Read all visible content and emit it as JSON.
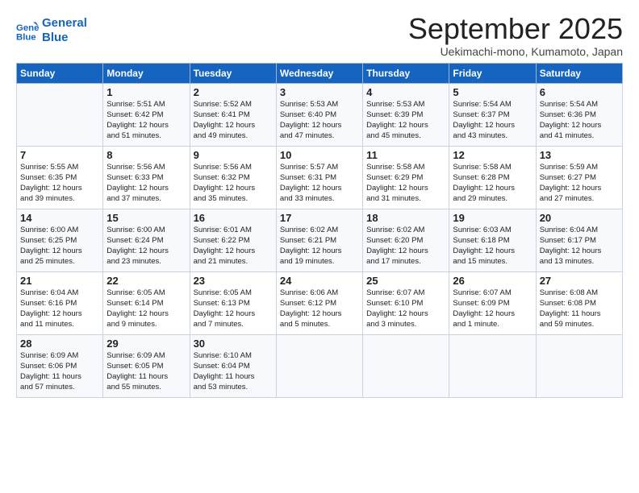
{
  "logo": {
    "line1": "General",
    "line2": "Blue"
  },
  "title": "September 2025",
  "subtitle": "Uekimachi-mono, Kumamoto, Japan",
  "headers": [
    "Sunday",
    "Monday",
    "Tuesday",
    "Wednesday",
    "Thursday",
    "Friday",
    "Saturday"
  ],
  "weeks": [
    [
      {
        "day": "",
        "text": ""
      },
      {
        "day": "1",
        "text": "Sunrise: 5:51 AM\nSunset: 6:42 PM\nDaylight: 12 hours\nand 51 minutes."
      },
      {
        "day": "2",
        "text": "Sunrise: 5:52 AM\nSunset: 6:41 PM\nDaylight: 12 hours\nand 49 minutes."
      },
      {
        "day": "3",
        "text": "Sunrise: 5:53 AM\nSunset: 6:40 PM\nDaylight: 12 hours\nand 47 minutes."
      },
      {
        "day": "4",
        "text": "Sunrise: 5:53 AM\nSunset: 6:39 PM\nDaylight: 12 hours\nand 45 minutes."
      },
      {
        "day": "5",
        "text": "Sunrise: 5:54 AM\nSunset: 6:37 PM\nDaylight: 12 hours\nand 43 minutes."
      },
      {
        "day": "6",
        "text": "Sunrise: 5:54 AM\nSunset: 6:36 PM\nDaylight: 12 hours\nand 41 minutes."
      }
    ],
    [
      {
        "day": "7",
        "text": "Sunrise: 5:55 AM\nSunset: 6:35 PM\nDaylight: 12 hours\nand 39 minutes."
      },
      {
        "day": "8",
        "text": "Sunrise: 5:56 AM\nSunset: 6:33 PM\nDaylight: 12 hours\nand 37 minutes."
      },
      {
        "day": "9",
        "text": "Sunrise: 5:56 AM\nSunset: 6:32 PM\nDaylight: 12 hours\nand 35 minutes."
      },
      {
        "day": "10",
        "text": "Sunrise: 5:57 AM\nSunset: 6:31 PM\nDaylight: 12 hours\nand 33 minutes."
      },
      {
        "day": "11",
        "text": "Sunrise: 5:58 AM\nSunset: 6:29 PM\nDaylight: 12 hours\nand 31 minutes."
      },
      {
        "day": "12",
        "text": "Sunrise: 5:58 AM\nSunset: 6:28 PM\nDaylight: 12 hours\nand 29 minutes."
      },
      {
        "day": "13",
        "text": "Sunrise: 5:59 AM\nSunset: 6:27 PM\nDaylight: 12 hours\nand 27 minutes."
      }
    ],
    [
      {
        "day": "14",
        "text": "Sunrise: 6:00 AM\nSunset: 6:25 PM\nDaylight: 12 hours\nand 25 minutes."
      },
      {
        "day": "15",
        "text": "Sunrise: 6:00 AM\nSunset: 6:24 PM\nDaylight: 12 hours\nand 23 minutes."
      },
      {
        "day": "16",
        "text": "Sunrise: 6:01 AM\nSunset: 6:22 PM\nDaylight: 12 hours\nand 21 minutes."
      },
      {
        "day": "17",
        "text": "Sunrise: 6:02 AM\nSunset: 6:21 PM\nDaylight: 12 hours\nand 19 minutes."
      },
      {
        "day": "18",
        "text": "Sunrise: 6:02 AM\nSunset: 6:20 PM\nDaylight: 12 hours\nand 17 minutes."
      },
      {
        "day": "19",
        "text": "Sunrise: 6:03 AM\nSunset: 6:18 PM\nDaylight: 12 hours\nand 15 minutes."
      },
      {
        "day": "20",
        "text": "Sunrise: 6:04 AM\nSunset: 6:17 PM\nDaylight: 12 hours\nand 13 minutes."
      }
    ],
    [
      {
        "day": "21",
        "text": "Sunrise: 6:04 AM\nSunset: 6:16 PM\nDaylight: 12 hours\nand 11 minutes."
      },
      {
        "day": "22",
        "text": "Sunrise: 6:05 AM\nSunset: 6:14 PM\nDaylight: 12 hours\nand 9 minutes."
      },
      {
        "day": "23",
        "text": "Sunrise: 6:05 AM\nSunset: 6:13 PM\nDaylight: 12 hours\nand 7 minutes."
      },
      {
        "day": "24",
        "text": "Sunrise: 6:06 AM\nSunset: 6:12 PM\nDaylight: 12 hours\nand 5 minutes."
      },
      {
        "day": "25",
        "text": "Sunrise: 6:07 AM\nSunset: 6:10 PM\nDaylight: 12 hours\nand 3 minutes."
      },
      {
        "day": "26",
        "text": "Sunrise: 6:07 AM\nSunset: 6:09 PM\nDaylight: 12 hours\nand 1 minute."
      },
      {
        "day": "27",
        "text": "Sunrise: 6:08 AM\nSunset: 6:08 PM\nDaylight: 11 hours\nand 59 minutes."
      }
    ],
    [
      {
        "day": "28",
        "text": "Sunrise: 6:09 AM\nSunset: 6:06 PM\nDaylight: 11 hours\nand 57 minutes."
      },
      {
        "day": "29",
        "text": "Sunrise: 6:09 AM\nSunset: 6:05 PM\nDaylight: 11 hours\nand 55 minutes."
      },
      {
        "day": "30",
        "text": "Sunrise: 6:10 AM\nSunset: 6:04 PM\nDaylight: 11 hours\nand 53 minutes."
      },
      {
        "day": "",
        "text": ""
      },
      {
        "day": "",
        "text": ""
      },
      {
        "day": "",
        "text": ""
      },
      {
        "day": "",
        "text": ""
      }
    ]
  ]
}
